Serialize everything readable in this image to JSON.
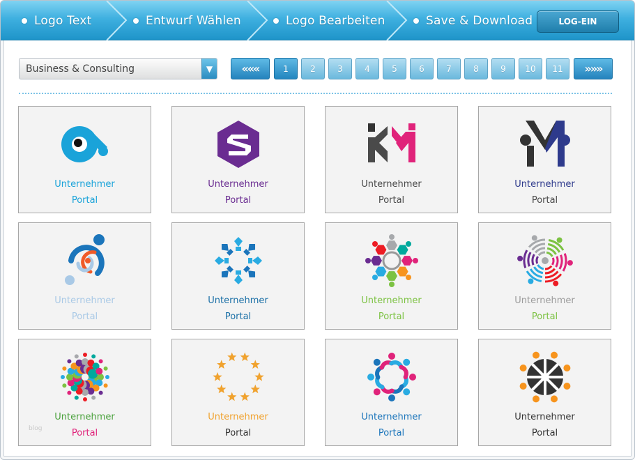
{
  "wizard": {
    "steps": [
      "Logo Text",
      "Entwurf Wählen",
      "Logo Bearbeiten",
      "Save & Download"
    ],
    "login_label": "LOG-EIN"
  },
  "filter": {
    "category": "Business & Consulting"
  },
  "pagination": {
    "prev_label": "«««",
    "next_label": "»»»",
    "pages": [
      "1",
      "2",
      "3",
      "4",
      "5",
      "6",
      "7",
      "8",
      "9",
      "10",
      "11"
    ],
    "current": "1"
  },
  "logos": [
    {
      "line1": "Unternehmer",
      "line2": "Portal",
      "color1": "#1aa3d9",
      "color2": "#1aa3d9",
      "icon": "eye-infinity-icon"
    },
    {
      "line1": "Unternehmer",
      "line2": "Portal",
      "color1": "#6a2c91",
      "color2": "#6a2c91",
      "icon": "hexagon-s-icon"
    },
    {
      "line1": "Unternehmer",
      "line2": "Portal",
      "color1": "#4a4a4a",
      "color2": "#4a4a4a",
      "icon": "km-monogram-icon"
    },
    {
      "line1": "Unternehmer",
      "line2": "Portal",
      "color1": "#2e3a8c",
      "color2": "#4a4a4a",
      "icon": "m-people-icon"
    },
    {
      "line1": "Unternehmer",
      "line2": "Portal",
      "color1": "#a9c9e6",
      "color2": "#a9c9e6",
      "icon": "orbit-people-icon"
    },
    {
      "line1": "Unternehmer",
      "line2": "Portal",
      "color1": "#1a6fa6",
      "color2": "#1a6fa6",
      "icon": "blue-ring-people-icon"
    },
    {
      "line1": "Unternehmer",
      "line2": "Portal",
      "color1": "#7cc242",
      "color2": "#7cc242",
      "icon": "hexagon-ring-people-icon"
    },
    {
      "line1": "Unternehmer",
      "line2": "Portal",
      "color1": "#9b9b9b",
      "color2": "#7cc242",
      "icon": "signal-people-icon"
    },
    {
      "line1": "Unternehmer",
      "line2": "Portal",
      "color1": "#4aa13c",
      "color2": "#e0237a",
      "icon": "dot-burst-icon"
    },
    {
      "line1": "Unternehmer",
      "line2": "Portal",
      "color1": "#f0a22e",
      "color2": "#333333",
      "icon": "star-ring-people-icon"
    },
    {
      "line1": "Unternehmer",
      "line2": "Portal",
      "color1": "#1b75bb",
      "color2": "#1b75bb",
      "icon": "colorful-ring-people-icon"
    },
    {
      "line1": "Unternehmer",
      "line2": "Portal",
      "color1": "#333333",
      "color2": "#333333",
      "icon": "dark-wheel-people-icon"
    }
  ],
  "watermark": "blog"
}
